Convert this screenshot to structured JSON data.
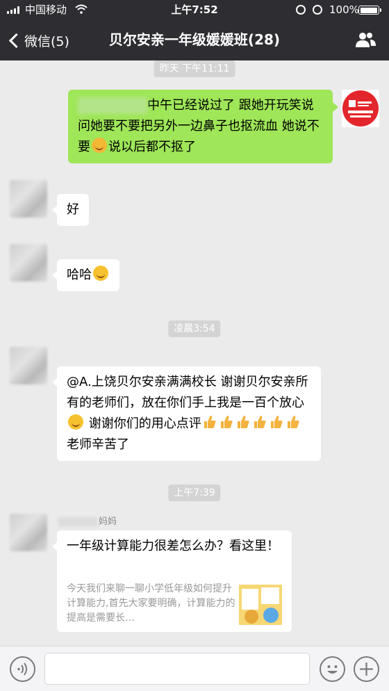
{
  "status_bar": {
    "carrier": "中国移动",
    "time": "上午7:52",
    "battery": "100%",
    "battery_level": 1.0
  },
  "nav": {
    "back_label": "微信(5)",
    "title": "贝尔安亲一年级媛媛班(28)"
  },
  "messages": {
    "t1": "昨天 下午11:11",
    "m1_text": "中午已经说过了 跟她开玩笑说问她要不要把另外一边鼻子也抠流血 她说不要",
    "m1_tail": "说以后都不抠了",
    "m2_text": "好",
    "m3_text": "哈哈",
    "t2": "凌晨3:54",
    "m4_text": "@A.上饶贝尔安亲满满校长 谢谢贝尔安亲所有的老师们，放在你们手上我是一百个放心",
    "m4_mid": " 谢谢你们的用心点评",
    "m4_tail": "老师辛苦了",
    "t3": "上午7:39",
    "m5_sender": "妈妈",
    "card_title": "一年级计算能力很差怎么办？看这里！",
    "card_desc": "今天我们来聊一聊小学低年级如何提升计算能力,首先大家要明确，计算能力的提高是需要长…"
  },
  "icons": {
    "back": "chevron-left-icon",
    "members": "group-members-icon",
    "voice": "voice-icon",
    "emoji": "emoji-icon",
    "plus": "plus-icon"
  },
  "colors": {
    "nav_bg": "#2e2d32",
    "chat_bg": "#ebebeb",
    "sent_bubble": "#9fe658",
    "received_bubble": "#ffffff"
  }
}
